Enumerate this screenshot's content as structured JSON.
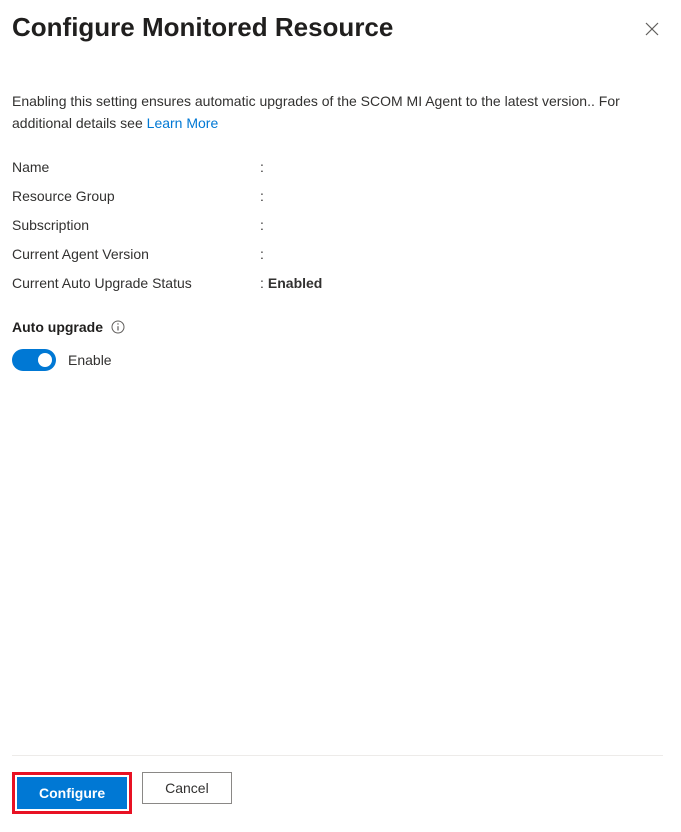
{
  "header": {
    "title": "Configure Monitored Resource"
  },
  "description": {
    "text": "Enabling this setting ensures automatic upgrades of the SCOM MI Agent to the latest version.. For additional details see ",
    "link_label": "Learn More"
  },
  "fields": {
    "name": {
      "label": "Name",
      "value": ""
    },
    "resource_group": {
      "label": "Resource Group",
      "value": ""
    },
    "subscription": {
      "label": "Subscription",
      "value": ""
    },
    "current_agent_version": {
      "label": "Current Agent Version",
      "value": ""
    },
    "current_auto_upgrade_status": {
      "label": "Current Auto Upgrade Status",
      "value": "Enabled"
    }
  },
  "auto_upgrade": {
    "heading": "Auto upgrade",
    "toggle_label": "Enable",
    "toggle_on": true
  },
  "footer": {
    "primary_label": "Configure",
    "secondary_label": "Cancel"
  }
}
